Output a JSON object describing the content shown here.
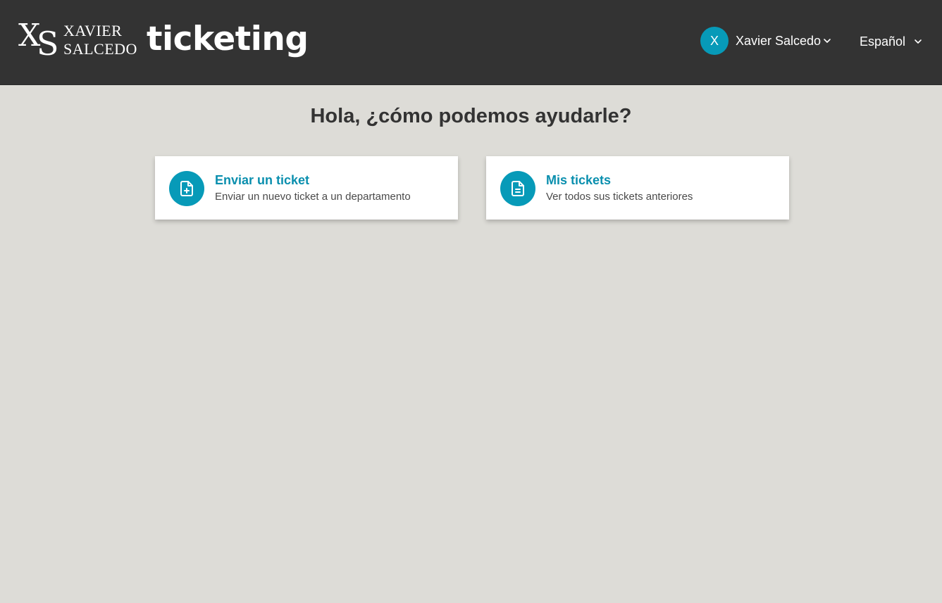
{
  "header": {
    "logo_line1": "XAVIER",
    "logo_line2": "SALCEDO",
    "logo_mark_x": "X",
    "logo_mark_s": "S",
    "brand_word": "ticketing",
    "user": {
      "avatar_letter": "X",
      "name": "Xavier Salcedo",
      "icon": "chevron-down-icon"
    },
    "language": {
      "selected": "Español",
      "icon": "chevron-down-icon"
    }
  },
  "main": {
    "heading": "Hola, ¿cómo podemos ayudarle?",
    "cards": [
      {
        "title": "Enviar un ticket",
        "description": "Enviar un nuevo ticket a un departamento",
        "icon": "file-plus-icon"
      },
      {
        "title": "Mis tickets",
        "description": "Ver todos sus tickets anteriores",
        "icon": "file-text-icon"
      }
    ]
  },
  "colors": {
    "header_bg": "#333333",
    "page_bg": "#dddcd7",
    "accent": "#079ab8",
    "card_title": "#0a8fae"
  }
}
